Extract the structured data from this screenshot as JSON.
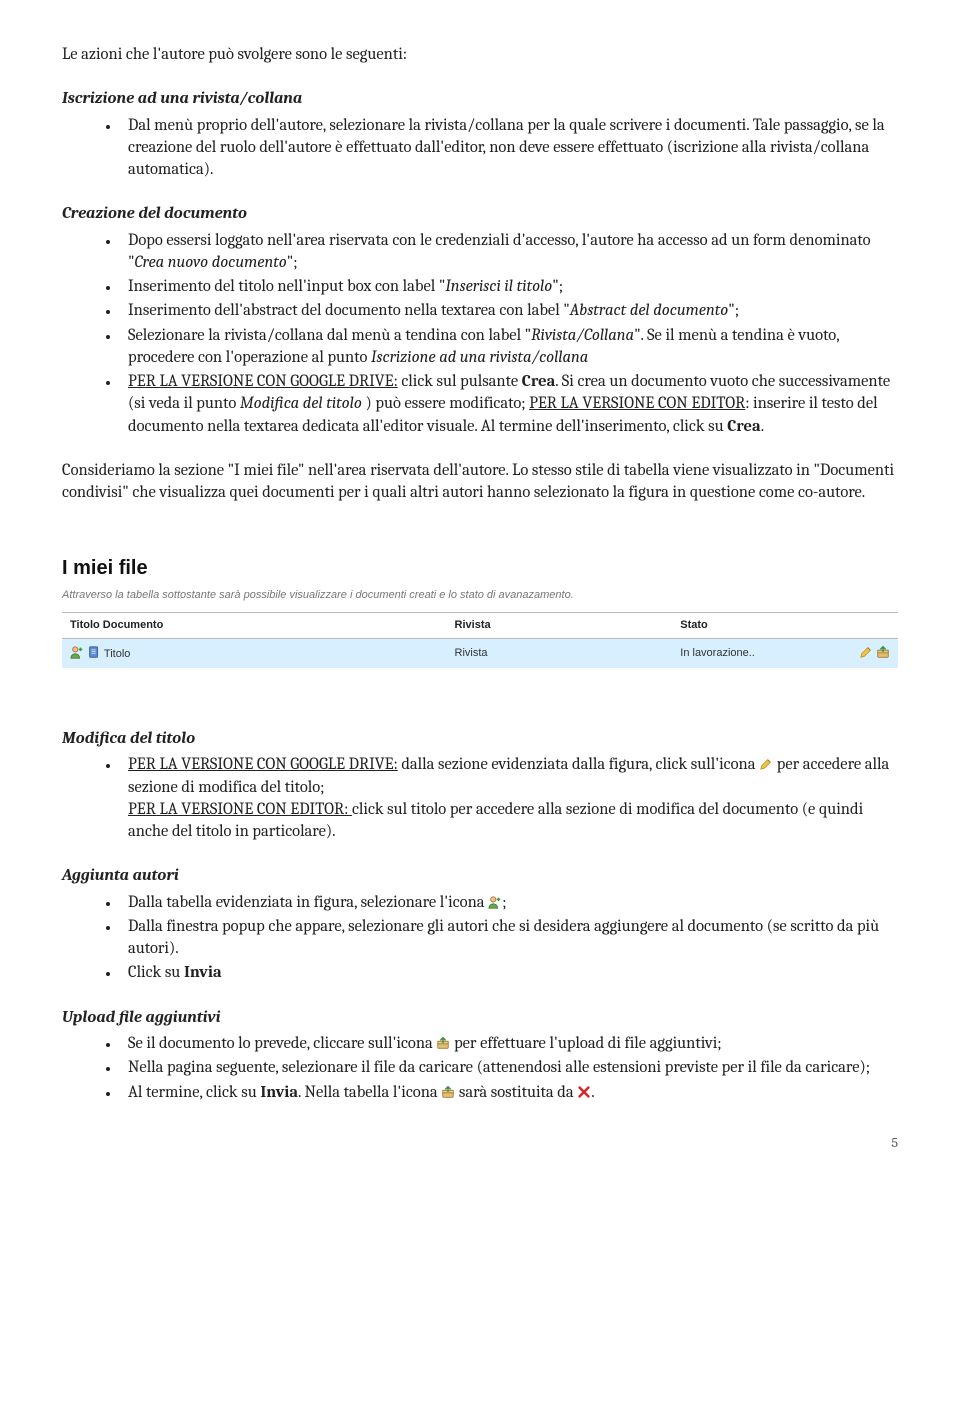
{
  "intro": "Le azioni che l'autore può svolgere sono le seguenti:",
  "sec1": {
    "title": "Iscrizione ad una rivista/collana",
    "li1": "Dal menù proprio dell'autore, selezionare la rivista/collana per la quale scrivere i documenti. Tale passaggio, se la creazione del ruolo dell'autore è effettuato dall'editor, non deve essere effettuato (iscrizione alla rivista/collana automatica)."
  },
  "sec2": {
    "title": "Creazione del documento",
    "li1_a": "Dopo essersi loggato nell'area riservata con le credenziali d'accesso, l'autore ha accesso ad un form denominato \"",
    "li1_em": "Crea nuovo documento",
    "li1_b": "\";",
    "li2_a": "Inserimento del titolo nell'input box con label \"",
    "li2_em": "Inserisci il titolo",
    "li2_b": "\";",
    "li3_a": "Inserimento dell'abstract del documento nella textarea con label \"",
    "li3_em": "Abstract del documento",
    "li3_b": "\";",
    "li4_a": "Selezionare la rivista/collana dal menù a tendina con label \"",
    "li4_em1": "Rivista/Collana",
    "li4_b": "\". Se il menù a tendina è vuoto, procedere con l'operazione al punto ",
    "li4_em2": "Iscrizione ad una rivista/collana",
    "li5_u1": "PER LA VERSIONE CON GOOGLE DRIVE:",
    "li5_a": " click sul pulsante ",
    "li5_b1": "Crea",
    "li5_c": ". Si crea un documento vuoto che successivamente (si veda il punto ",
    "li5_em": "Modifica del titolo ",
    "li5_d": ") può essere modificato; ",
    "li5_u2": "PER LA VERSIONE CON EDITOR",
    "li5_e": ": inserire il testo del documento nella textarea dedicata all'editor visuale. Al termine dell'inserimento, click su ",
    "li5_b2": "Crea",
    "li5_f": "."
  },
  "midpara": "Consideriamo la sezione \"I miei file\" nell'area riservata dell'autore. Lo stesso stile di tabella viene visualizzato in \"Documenti condivisi\" che visualizza quei documenti per i quali altri autori hanno selezionato la figura in questione come co-autore.",
  "screenshot": {
    "title": "I miei file",
    "subtitle": "Attraverso la tabella sottostante sarà possibile visualizzare i documenti creati e lo stato di avanazamento.",
    "col1": "Titolo Documento",
    "col2": "Rivista",
    "col3": "Stato",
    "row": {
      "titolo": "Titolo",
      "rivista": "Rivista",
      "stato": "In lavorazione.."
    }
  },
  "sec3": {
    "title": "Modifica del titolo",
    "li1_u1": "PER LA VERSIONE CON GOOGLE DRIVE:",
    "li1_a": " dalla sezione evidenziata dalla figura, click sull'icona ",
    "li1_b": " per accedere alla sezione di modifica del titolo;",
    "li1_u2": "PER LA VERSIONE CON EDITOR: ",
    "li1_c": "click sul titolo per accedere alla sezione di modifica del documento (e quindi anche del titolo in particolare)."
  },
  "sec4": {
    "title": "Aggiunta autori",
    "li1_a": "Dalla tabella evidenziata in figura, selezionare l'icona ",
    "li1_b": ";",
    "li2": "Dalla finestra popup che appare, selezionare gli autori che si desidera aggiungere al documento (se scritto da più autori).",
    "li3_a": "Click su ",
    "li3_b": "Invia"
  },
  "sec5": {
    "title": "Upload file aggiuntivi",
    "li1_a": "Se il documento lo prevede, cliccare sull'icona ",
    "li1_b": " per effettuare l'upload di file aggiuntivi;",
    "li2": "Nella pagina seguente, selezionare il file da caricare (attenendosi alle estensioni previste per il file da caricare);",
    "li3_a": "Al termine, click su ",
    "li3_b": "Invia",
    "li3_c": ". Nella tabella l'icona ",
    "li3_d": " sarà sostituita da ",
    "li3_e": "."
  },
  "pagenum": "5"
}
